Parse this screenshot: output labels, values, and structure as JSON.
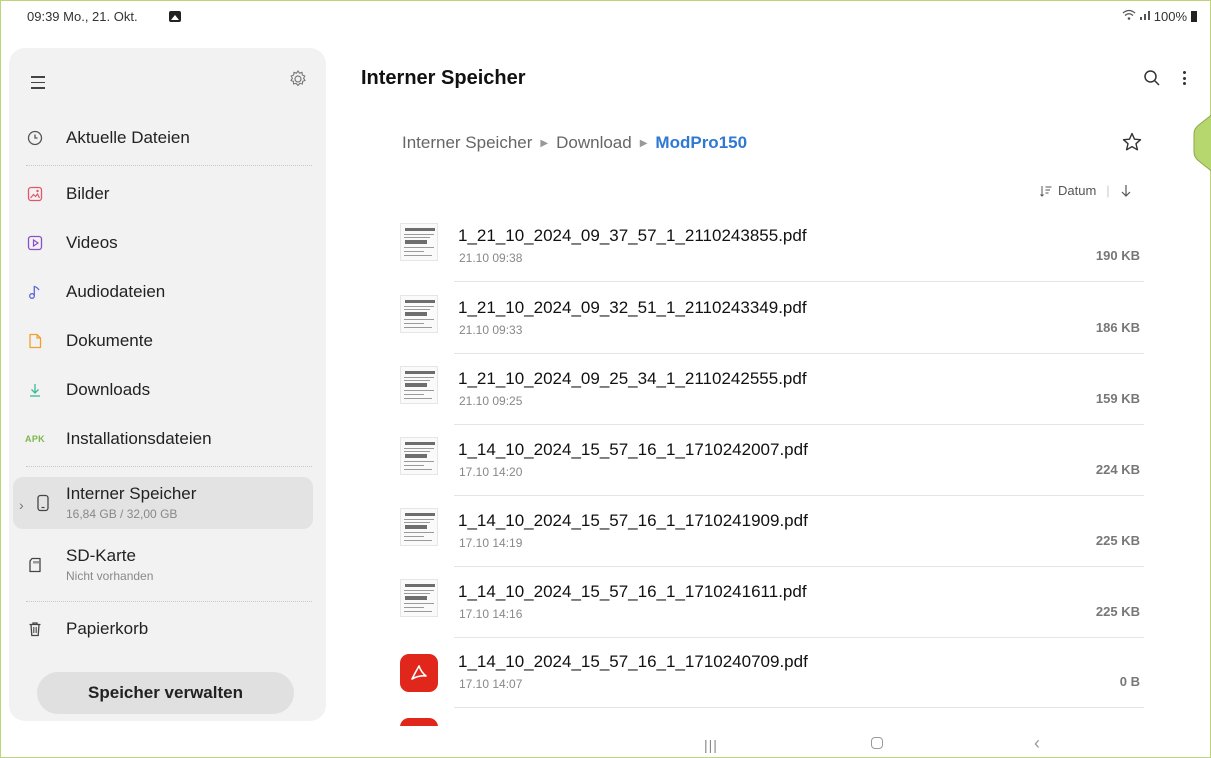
{
  "status_bar": {
    "time_date": "09:39  Mo., 21. Okt.",
    "battery": "100%",
    "icons": [
      "image-notification-icon",
      "wifi-icon",
      "signal-icon",
      "battery-icon"
    ]
  },
  "sidebar": {
    "items": [
      {
        "label": "Aktuelle Dateien",
        "icon": "clock-icon"
      },
      {
        "label": "Bilder",
        "icon": "image-icon"
      },
      {
        "label": "Videos",
        "icon": "video-icon"
      },
      {
        "label": "Audiodateien",
        "icon": "music-note-icon"
      },
      {
        "label": "Dokumente",
        "icon": "document-icon"
      },
      {
        "label": "Downloads",
        "icon": "download-icon"
      },
      {
        "label": "Installationsdateien",
        "icon": "apk-icon",
        "badge": "APK"
      }
    ],
    "storage": [
      {
        "label": "Interner Speicher",
        "sub": "16,84 GB / 32,00 GB",
        "icon": "phone-icon",
        "selected": true
      },
      {
        "label": "SD-Karte",
        "sub": "Nicht vorhanden",
        "icon": "sd-card-icon"
      }
    ],
    "trash": {
      "label": "Papierkorb",
      "icon": "trash-icon"
    },
    "manage_button": "Speicher verwalten"
  },
  "main": {
    "title": "Interner Speicher",
    "breadcrumb": [
      "Interner Speicher",
      "Download",
      "ModPro150"
    ],
    "sort": {
      "label": "Datum"
    },
    "files": [
      {
        "name": "1_21_10_2024_09_37_57_1_2110243855.pdf",
        "date": "21.10 09:38",
        "size": "190 KB",
        "thumb": "page"
      },
      {
        "name": "1_21_10_2024_09_32_51_1_2110243349.pdf",
        "date": "21.10 09:33",
        "size": "186 KB",
        "thumb": "page"
      },
      {
        "name": "1_21_10_2024_09_25_34_1_2110242555.pdf",
        "date": "21.10 09:25",
        "size": "159 KB",
        "thumb": "page"
      },
      {
        "name": "1_14_10_2024_15_57_16_1_1710242007.pdf",
        "date": "17.10 14:20",
        "size": "224 KB",
        "thumb": "page"
      },
      {
        "name": "1_14_10_2024_15_57_16_1_1710241909.pdf",
        "date": "17.10 14:19",
        "size": "225 KB",
        "thumb": "page"
      },
      {
        "name": "1_14_10_2024_15_57_16_1_1710241611.pdf",
        "date": "17.10 14:16",
        "size": "225 KB",
        "thumb": "page"
      },
      {
        "name": "1_14_10_2024_15_57_16_1_1710240709.pdf",
        "date": "17.10 14:07",
        "size": "0 B",
        "thumb": "pdf"
      }
    ]
  },
  "colors": {
    "accent": "#2f78d4",
    "sidebar_bg": "#f2f2f2",
    "selected_bg": "#e3e3e3",
    "pdf_red": "#e1261c",
    "apk_green": "#7ab84a"
  }
}
